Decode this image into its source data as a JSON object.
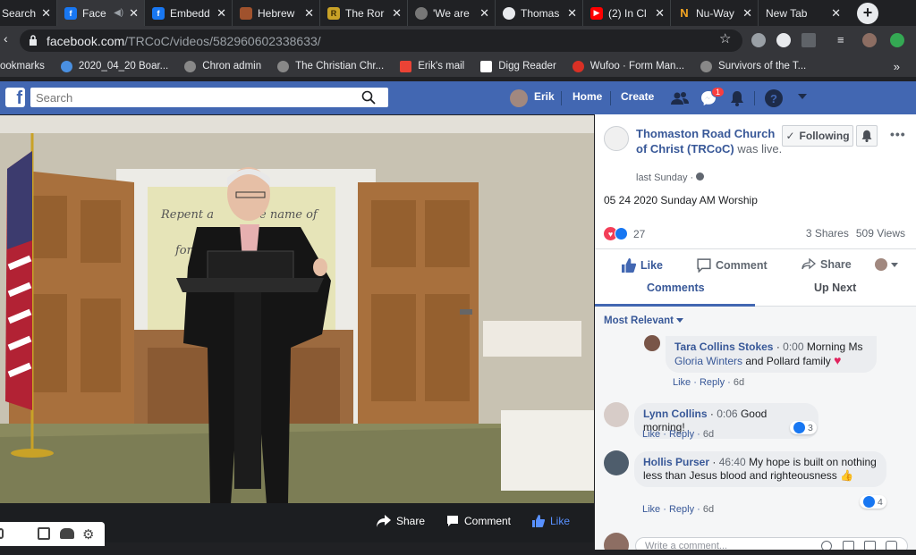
{
  "browser": {
    "tabs": [
      {
        "title": "Search",
        "color": "#4285f4",
        "letter": ""
      },
      {
        "title": "Face",
        "color": "#1877f2",
        "letter": "f"
      },
      {
        "title": "Embedd",
        "color": "#1877f2",
        "letter": "f"
      },
      {
        "title": "Hebrew",
        "color": "#a0522d",
        "letter": ""
      },
      {
        "title": "The Ror",
        "color": "#c9a227",
        "letter": "R"
      },
      {
        "title": "'We are",
        "color": "#888888",
        "letter": ""
      },
      {
        "title": "Thomas",
        "color": "#e8eaed",
        "letter": ""
      },
      {
        "title": "(2) In Cl",
        "color": "#ff0000",
        "letter": ""
      },
      {
        "title": "Nu-Way",
        "color": "#f5a623",
        "letter": ""
      },
      {
        "title": "New Tab",
        "color": "",
        "letter": ""
      }
    ],
    "url_host": "facebook.com",
    "url_path": "/TRCoC/videos/582960602338633/",
    "bookmarks": [
      {
        "label": "ookmarks",
        "color": ""
      },
      {
        "label": "2020_04_20 Boar...",
        "color": "#4a90e2"
      },
      {
        "label": "Chron admin",
        "color": "#888888"
      },
      {
        "label": "The Christian Chr...",
        "color": "#888888"
      },
      {
        "label": "Erik's mail",
        "color": "#ea4335"
      },
      {
        "label": "Digg Reader",
        "color": "#ffffff"
      },
      {
        "label": "Wufoo · Form Man...",
        "color": "#d93025"
      },
      {
        "label": "Survivors of the T...",
        "color": "#888888"
      }
    ],
    "bookmarks_more": "»"
  },
  "fb": {
    "logo": "f",
    "search_placeholder": "Search",
    "user": "Erik",
    "home": "Home",
    "create": "Create",
    "messenger_badge": "1"
  },
  "video": {
    "wall_text_1": "Repent a",
    "wall_text_2": "e name of",
    "wall_text_3": "for th",
    "share": "Share",
    "comment": "Comment",
    "like": "Like"
  },
  "post": {
    "page_name": "Thomaston Road Church of Christ (TRCoC)",
    "was_live": "was live.",
    "time": "last Sunday ·",
    "description": "05 24 2020 Sunday AM Worship",
    "reactions": "27",
    "shares": "3 Shares",
    "views": "509 Views",
    "following": "Following",
    "like": "Like",
    "comment": "Comment",
    "share": "Share",
    "tab_comments": "Comments",
    "tab_upnext": "Up Next",
    "sort": "Most Relevant"
  },
  "comments": [
    {
      "name": "Tara Collins Stokes",
      "ts": "0:00",
      "text": "Morning Ms",
      "text2_link": "Gloria Winters",
      "text2": "and Pollard family",
      "like": "Like",
      "reply": "Reply",
      "age": "6d"
    },
    {
      "name": "Lynn Collins",
      "ts": "0:06",
      "text": "Good morning!",
      "likes": "3",
      "like": "Like",
      "reply": "Reply",
      "age": "6d"
    },
    {
      "name": "Hollis Purser",
      "ts": "46:40",
      "text": "My hope is built on nothing less than Jesus blood and righteousness",
      "likes": "4",
      "like": "Like",
      "reply": "Reply",
      "age": "6d"
    }
  ],
  "write_comment": "Write a comment..."
}
